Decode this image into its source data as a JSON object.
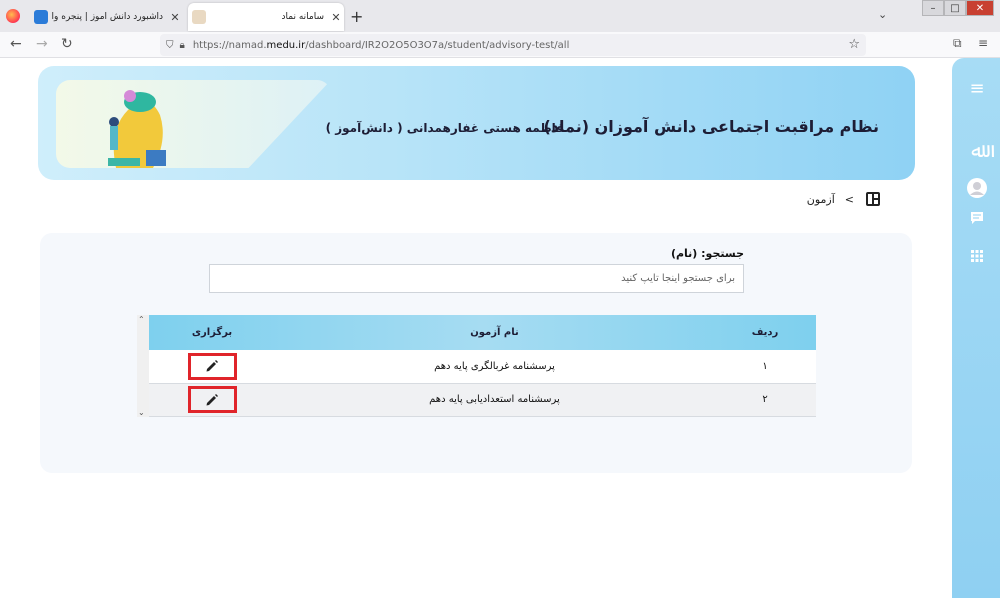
{
  "browser": {
    "tabs": [
      {
        "title": "داشبورد دانش آموز | پنجره واحد خد",
        "active": false
      },
      {
        "title": "سامانه نماد",
        "active": true
      }
    ],
    "url_prefix": "https://namad.",
    "url_domain": "medu.ir",
    "url_path": "/dashboard/IR2O2O5O3O7a/student/advisory-test/all"
  },
  "banner": {
    "title": "نظام مراقبت اجتماعی دانش آموزان (نماد)",
    "user": "فاطمه هستی غفارهمدانی ( دانش‌آموز )"
  },
  "breadcrumb": {
    "separator": ">",
    "current": "آزمون"
  },
  "search": {
    "label": "جستجو: (نام)",
    "placeholder": "برای جستجو اینجا تایپ کنید"
  },
  "table": {
    "headers": {
      "row": "ردیف",
      "name": "نام آزمون",
      "action": "برگزاری"
    },
    "rows": [
      {
        "row": "۱",
        "name": "پرسشنامه غربالگری پایه دهم"
      },
      {
        "row": "۲",
        "name": "پرسشنامه استعدادیابی پایه دهم"
      }
    ]
  },
  "colors": {
    "sidebar": "#8fd0f2",
    "table_header": "#7ed0ee",
    "highlight_border": "#e0242a"
  }
}
